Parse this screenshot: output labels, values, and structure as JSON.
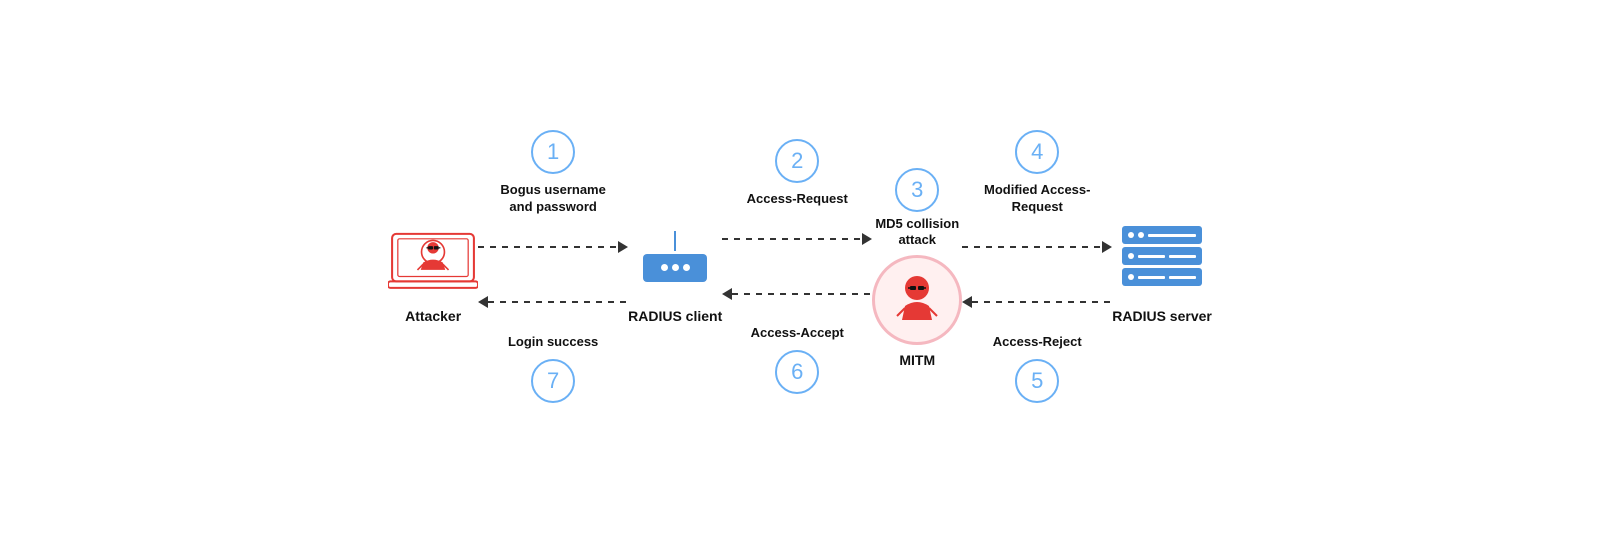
{
  "diagram": {
    "nodes": {
      "attacker": {
        "label": "Attacker"
      },
      "radius_client": {
        "label": "RADIUS\nclient"
      },
      "mitm": {
        "label": "MITM"
      },
      "radius_server": {
        "label": "RADIUS\nserver"
      }
    },
    "steps": {
      "1": {
        "number": "1",
        "label": "Bogus username\nand password",
        "direction": "right"
      },
      "2": {
        "number": "2",
        "label": "Access-Request",
        "direction": "right"
      },
      "3": {
        "number": "3",
        "label": "MD5 collision\nattack"
      },
      "4": {
        "number": "4",
        "label": "Modified Access-\nRequest",
        "direction": "right"
      },
      "5": {
        "number": "5",
        "label": "Access-Reject",
        "direction": "left"
      },
      "6": {
        "number": "6",
        "label": "Access-Accept",
        "direction": "left"
      },
      "7": {
        "number": "7",
        "label": "Login success",
        "direction": "left"
      }
    }
  }
}
